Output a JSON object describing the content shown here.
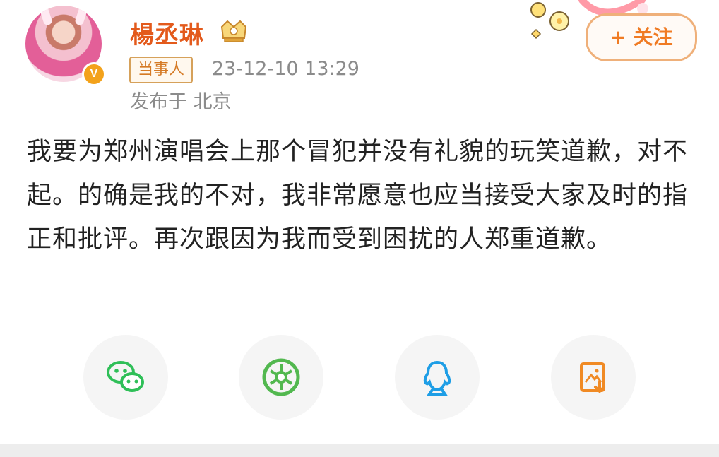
{
  "profile": {
    "username": "楊丞琳",
    "badge": "当事人",
    "timestamp": "23-12-10 13:29",
    "location": "发布于 北京",
    "verified_mark": "V",
    "follow_label": "+ 关注"
  },
  "post": {
    "text": "我要为郑州演唱会上那个冒犯并没有礼貌的玩笑道歉，对不起。的确是我的不对，我非常愿意也应当接受大家及时的指正和批评。再次跟因为我而受到困扰的人郑重道歉。"
  },
  "share_icons": [
    "wechat-icon",
    "moments-icon",
    "qq-icon",
    "save-image-icon"
  ],
  "colors": {
    "username": "#e35a1c",
    "follow": "#f07b24",
    "badge": "#d57a25",
    "wechat": "#2fbf58",
    "moments": "#52b84f",
    "qq": "#1e9ee6",
    "save": "#f08a24"
  }
}
